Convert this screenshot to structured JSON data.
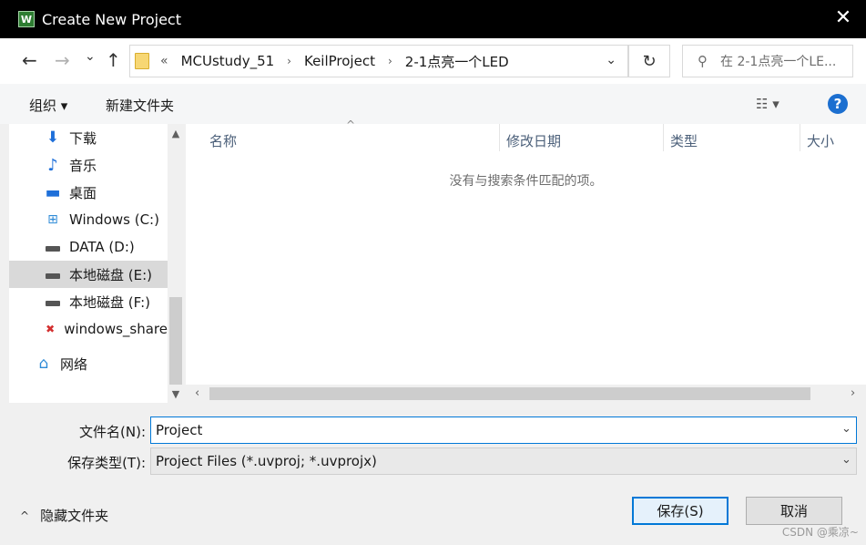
{
  "window": {
    "title": "Create New Project",
    "icon_glyph": "W",
    "close_glyph": "✕"
  },
  "nav": {
    "back_glyph": "←",
    "forward_glyph": "→",
    "recent_glyph": "⌄",
    "up_glyph": "↑",
    "refresh_glyph": "↻",
    "address_dropdown_glyph": "⌄",
    "breadcrumb_overflow": "«",
    "breadcrumbs": [
      "MCUstudy_51",
      "KeilProject",
      "2-1点亮一个LED"
    ],
    "breadcrumb_sep": "›",
    "search_placeholder": "在 2-1点亮一个LE...",
    "search_glyph": "⚲"
  },
  "toolbar": {
    "organize_label": "组织 ▾",
    "new_folder_label": "新建文件夹",
    "view_glyph": "☷ ▾",
    "help_glyph": "?"
  },
  "navpane": {
    "items": [
      {
        "label": "下载",
        "icon": "⬇"
      },
      {
        "label": "音乐",
        "icon": "♪"
      },
      {
        "label": "桌面",
        "icon": "▬"
      },
      {
        "label": "Windows (C:)",
        "icon": "⊞"
      },
      {
        "label": "DATA (D:)",
        "icon": "drive"
      },
      {
        "label": "本地磁盘 (E:)",
        "icon": "drive"
      },
      {
        "label": "本地磁盘 (F:)",
        "icon": "drive"
      },
      {
        "label": "windows_share",
        "icon": "✖"
      },
      {
        "label": "网络",
        "icon": "⌂"
      }
    ],
    "scroll_up_glyph": "▲",
    "scroll_down_glyph": "▼"
  },
  "filelist": {
    "columns": [
      "名称",
      "修改日期",
      "类型",
      "大小"
    ],
    "sort_glyph": "^",
    "empty_message": "没有与搜索条件匹配的项。",
    "scroll_left_glyph": "‹",
    "scroll_right_glyph": "›"
  },
  "form": {
    "filename_label": "文件名(N):",
    "filename_value": "Project",
    "filetype_label": "保存类型(T):",
    "filetype_value": "Project Files (*.uvproj; *.uvprojx)",
    "dropdown_glyph": "⌄"
  },
  "footer": {
    "hide_folders_label": "隐藏文件夹",
    "hide_glyph": "^",
    "save_label": "保存(S)",
    "cancel_label": "取消",
    "watermark": "CSDN @乘凉~"
  },
  "colors": {
    "accent": "#0078d7",
    "titlebar": "#000000",
    "selected_row": "#d9d9d9"
  }
}
